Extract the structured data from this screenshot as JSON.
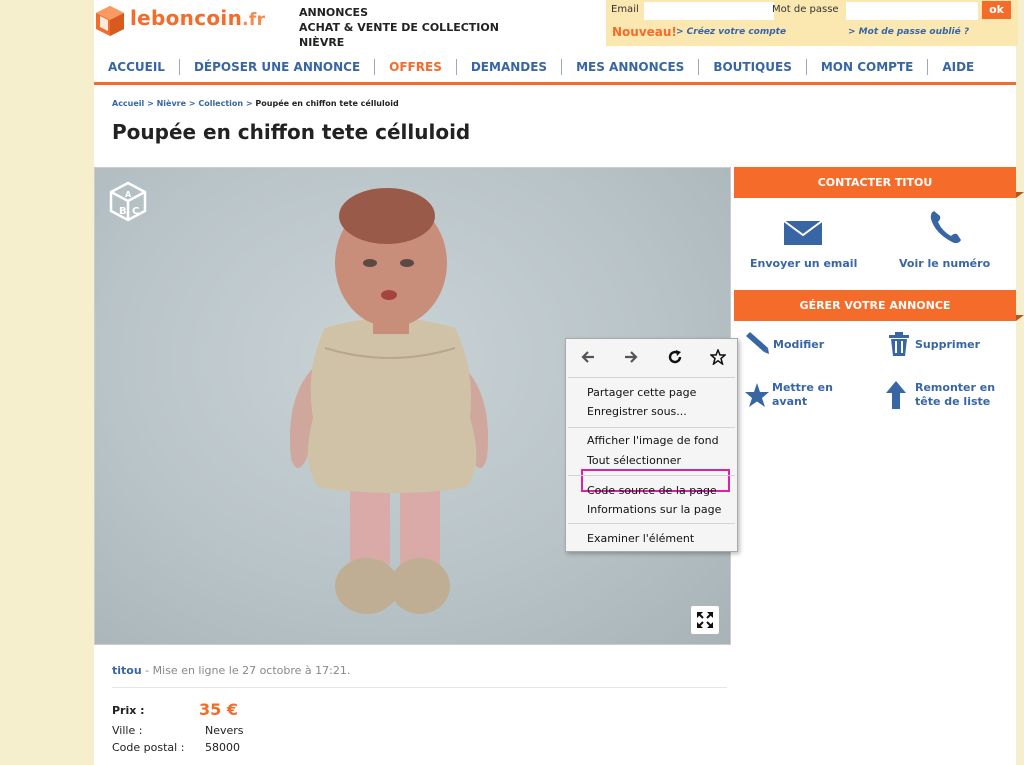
{
  "header": {
    "logo_text": "leboncoin",
    "logo_tld": ".fr",
    "tagline": [
      "ANNONCES",
      "ACHAT & VENTE DE COLLECTION",
      "NIÈVRE"
    ],
    "login": {
      "email_label": "Email",
      "password_label": "Mot de passe",
      "ok_label": "ok",
      "nouveau": "Nouveau!",
      "create_account": "> Créez votre compte",
      "forgot_password": "> Mot de passe oublié ?"
    }
  },
  "nav": {
    "items": [
      "ACCUEIL",
      "DÉPOSER UNE ANNONCE",
      "OFFRES",
      "DEMANDES",
      "MES ANNONCES",
      "BOUTIQUES",
      "MON COMPTE",
      "AIDE"
    ],
    "active": "OFFRES"
  },
  "breadcrumb": {
    "links": [
      "Accueil",
      "Nièvre",
      "Collection"
    ],
    "separator": ">",
    "current": "Poupée en chiffon tete célluloid"
  },
  "title": "Poupée en chiffon tete célluloid",
  "context_menu": {
    "nav_icons": [
      "back-icon",
      "forward-icon",
      "reload-icon",
      "bookmark-star-icon"
    ],
    "items": [
      "Partager cette page",
      "Enregistrer sous...",
      "Afficher l'image de fond",
      "Tout sélectionner",
      "Code source de la page",
      "Informations sur la page",
      "Examiner l'élément"
    ],
    "highlighted_index": 1
  },
  "contact": {
    "header": "CONTACTER TITOU",
    "email_label": "Envoyer un email",
    "phone_label": "Voir le numéro"
  },
  "manage": {
    "header": "GÉRER VOTRE ANNONCE",
    "edit": "Modifier",
    "delete": "Supprimer",
    "feature": [
      "Mettre en",
      "avant"
    ],
    "bump": [
      "Remonter en",
      "tête de liste"
    ]
  },
  "listing": {
    "seller": "titou",
    "posted": " - Mise en ligne le 27 octobre à 17:21.",
    "price_label": "Prix :",
    "price": "35 €",
    "city_label": "Ville :",
    "city": "Nevers",
    "postal_label": "Code postal :",
    "postal": "58000"
  },
  "colors": {
    "brand_orange": "#f56b2a",
    "link_blue": "#3866a4",
    "highlight_magenta": "#e020a8"
  }
}
